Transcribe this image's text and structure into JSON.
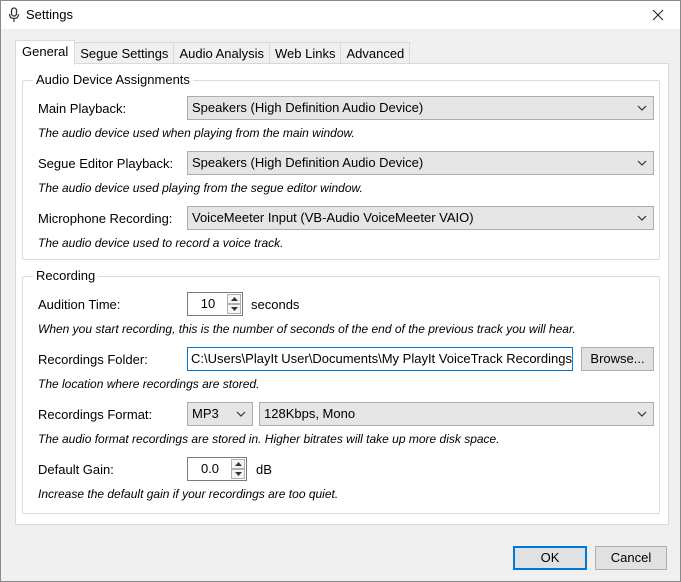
{
  "window": {
    "title": "Settings",
    "icon": "microphone-icon",
    "close_icon": "close-icon"
  },
  "tabs": [
    {
      "label": "General",
      "active": true
    },
    {
      "label": "Segue Settings",
      "active": false
    },
    {
      "label": "Audio Analysis",
      "active": false
    },
    {
      "label": "Web Links",
      "active": false
    },
    {
      "label": "Advanced",
      "active": false
    }
  ],
  "audio_devices": {
    "group_label": "Audio Device Assignments",
    "main_playback": {
      "label": "Main Playback:",
      "value": "Speakers (High Definition Audio Device)",
      "hint": "The audio device used when playing from the main window."
    },
    "segue_playback": {
      "label": "Segue Editor Playback:",
      "value": "Speakers (High Definition Audio Device)",
      "hint": "The audio device used playing from the segue editor window."
    },
    "microphone": {
      "label": "Microphone Recording:",
      "value": "VoiceMeeter Input (VB-Audio VoiceMeeter VAIO)",
      "hint": "The audio device used to record a voice track."
    }
  },
  "recording": {
    "group_label": "Recording",
    "audition_time": {
      "label": "Audition Time:",
      "value": "10",
      "unit": "seconds",
      "hint": "When you start recording, this is the number of seconds of the end of the previous track you will hear."
    },
    "folder": {
      "label": "Recordings Folder:",
      "value": "C:\\Users\\PlayIt User\\Documents\\My PlayIt VoiceTrack Recordings",
      "browse_label": "Browse...",
      "hint": "The location where recordings are stored."
    },
    "format": {
      "label": "Recordings Format:",
      "codec": "MP3",
      "quality": "128Kbps, Mono",
      "hint": "The audio format recordings are stored in. Higher bitrates will take up more disk space."
    },
    "gain": {
      "label": "Default Gain:",
      "value": "0.0",
      "unit": "dB",
      "hint": "Increase the default gain if your recordings are too quiet."
    }
  },
  "footer": {
    "ok_label": "OK",
    "cancel_label": "Cancel"
  }
}
